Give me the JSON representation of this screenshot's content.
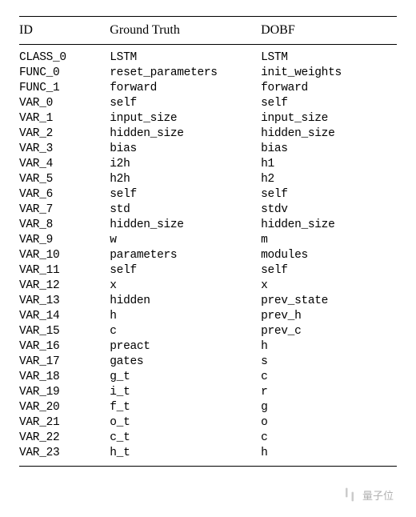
{
  "table": {
    "headers": [
      "ID",
      "Ground Truth",
      "DOBF"
    ],
    "rows": [
      {
        "id": "CLASS_0",
        "gt": "LSTM",
        "dobf": "LSTM"
      },
      {
        "id": "FUNC_0",
        "gt": "reset_parameters",
        "dobf": "init_weights"
      },
      {
        "id": "FUNC_1",
        "gt": "forward",
        "dobf": "forward"
      },
      {
        "id": "VAR_0",
        "gt": "self",
        "dobf": "self"
      },
      {
        "id": "VAR_1",
        "gt": "input_size",
        "dobf": "input_size"
      },
      {
        "id": "VAR_2",
        "gt": "hidden_size",
        "dobf": "hidden_size"
      },
      {
        "id": "VAR_3",
        "gt": "bias",
        "dobf": "bias"
      },
      {
        "id": "VAR_4",
        "gt": "i2h",
        "dobf": "h1"
      },
      {
        "id": "VAR_5",
        "gt": "h2h",
        "dobf": "h2"
      },
      {
        "id": "VAR_6",
        "gt": "self",
        "dobf": "self"
      },
      {
        "id": "VAR_7",
        "gt": "std",
        "dobf": "stdv"
      },
      {
        "id": "VAR_8",
        "gt": "hidden_size",
        "dobf": "hidden_size"
      },
      {
        "id": "VAR_9",
        "gt": "w",
        "dobf": "m"
      },
      {
        "id": "VAR_10",
        "gt": "parameters",
        "dobf": "modules"
      },
      {
        "id": "VAR_11",
        "gt": "self",
        "dobf": "self"
      },
      {
        "id": "VAR_12",
        "gt": "x",
        "dobf": "x"
      },
      {
        "id": "VAR_13",
        "gt": "hidden",
        "dobf": "prev_state"
      },
      {
        "id": "VAR_14",
        "gt": "h",
        "dobf": "prev_h"
      },
      {
        "id": "VAR_15",
        "gt": "c",
        "dobf": "prev_c"
      },
      {
        "id": "VAR_16",
        "gt": "preact",
        "dobf": "h"
      },
      {
        "id": "VAR_17",
        "gt": "gates",
        "dobf": "s"
      },
      {
        "id": "VAR_18",
        "gt": "g_t",
        "dobf": "c"
      },
      {
        "id": "VAR_19",
        "gt": "i_t",
        "dobf": "r"
      },
      {
        "id": "VAR_20",
        "gt": "f_t",
        "dobf": "g"
      },
      {
        "id": "VAR_21",
        "gt": "o_t",
        "dobf": "o"
      },
      {
        "id": "VAR_22",
        "gt": "c_t",
        "dobf": "c"
      },
      {
        "id": "VAR_23",
        "gt": "h_t",
        "dobf": "h"
      }
    ]
  },
  "watermark": {
    "text": "量子位"
  }
}
